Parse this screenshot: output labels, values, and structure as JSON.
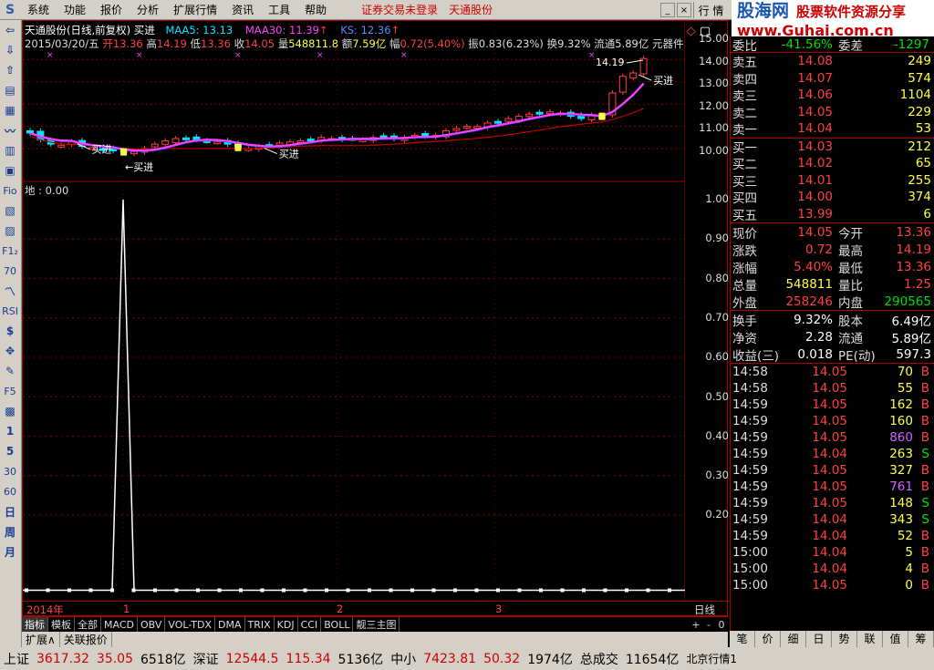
{
  "menu": {
    "logo": "S",
    "items": [
      "系统",
      "功能",
      "报价",
      "分析",
      "扩展行情",
      "资讯",
      "工具",
      "帮助"
    ],
    "alert": "证券交易未登录",
    "stock_name": "天通股份",
    "hq_tab": "行 情"
  },
  "brand": {
    "cn": "股海网",
    "slogan": "股票软件资源分享",
    "url": "www.Guhai.com.cn"
  },
  "toolbar": [
    "⇦",
    "⇩",
    "⇧",
    "▤",
    "▦",
    "〰",
    "▥",
    "▣",
    "Fio",
    "▧",
    "▨",
    "F1₂",
    "70",
    "〽",
    "RSI",
    "$",
    "✥",
    "✎",
    "F5",
    "▩",
    "1",
    "5",
    "30",
    "60",
    "日",
    "周",
    "月"
  ],
  "chart": {
    "line1": {
      "title": "天通股份(日线,前复权) 买进",
      "maa5": "MAA5: 13.13",
      "maa30": "MAA30: 11.39",
      "ks": "KS: 12.36"
    },
    "line2": {
      "date": "2015/03/20/五",
      "open_l": "开",
      "open": "13.36",
      "high_l": "高",
      "high": "14.19",
      "low_l": "低",
      "low": "13.36",
      "close_l": "收",
      "close": "14.05",
      "vol_l": "量",
      "vol": "548811.8",
      "amt_l": "额",
      "amt": "7.59亿",
      "chg_l": "幅",
      "chg": "0.72(5.40%)",
      "amp_l": "振",
      "amp": "0.83(6.23%)",
      "turn_l": "换",
      "turn": "9.32%",
      "float_l": "流通",
      "float": "5.89亿",
      "tool": "元器件"
    },
    "price_axis": [
      "15.00",
      "14.00",
      "13.00",
      "12.00",
      "11.00",
      "10.00"
    ],
    "high_marker": "14.19",
    "buy_labels": [
      "买进",
      "买进",
      "买进",
      "买进"
    ],
    "indicator_label": "地 : 0.00",
    "ind_axis": [
      "1.00",
      "0.90",
      "0.80",
      "0.70",
      "0.60",
      "0.50",
      "0.40",
      "0.30",
      "0.20"
    ],
    "dates": [
      "2014年",
      "1",
      "2",
      "3"
    ],
    "period": "日线"
  },
  "bottom_tabs": [
    "指标",
    "模板",
    "全部",
    "MACD",
    "OBV",
    "VOL-TDX",
    "DMA",
    "TRIX",
    "KDJ",
    "CCI",
    "BOLL",
    "靓三主图"
  ],
  "bottom_tabs_right": [
    "+",
    "-",
    "0"
  ],
  "bottom_tabs2": [
    "扩展∧",
    "关联报价"
  ],
  "quote": {
    "wb": {
      "label": "委比",
      "value": "-41.56%",
      "label2": "委差",
      "value2": "-1297"
    },
    "asks": [
      {
        "label": "卖五",
        "price": "14.08",
        "vol": "249"
      },
      {
        "label": "卖四",
        "price": "14.07",
        "vol": "574"
      },
      {
        "label": "卖三",
        "price": "14.06",
        "vol": "1104"
      },
      {
        "label": "卖二",
        "price": "14.05",
        "vol": "229"
      },
      {
        "label": "卖一",
        "price": "14.04",
        "vol": "53"
      }
    ],
    "bids": [
      {
        "label": "买一",
        "price": "14.03",
        "vol": "212"
      },
      {
        "label": "买二",
        "price": "14.02",
        "vol": "65"
      },
      {
        "label": "买三",
        "price": "14.01",
        "vol": "255"
      },
      {
        "label": "买四",
        "price": "14.00",
        "vol": "374"
      },
      {
        "label": "买五",
        "price": "13.99",
        "vol": "6"
      }
    ],
    "stats1": [
      {
        "k1": "现价",
        "v1": "14.05",
        "c1": "red",
        "k2": "今开",
        "v2": "13.36",
        "c2": "red"
      },
      {
        "k1": "涨跌",
        "v1": "0.72",
        "c1": "red",
        "k2": "最高",
        "v2": "14.19",
        "c2": "red"
      },
      {
        "k1": "涨幅",
        "v1": "5.40%",
        "c1": "red",
        "k2": "最低",
        "v2": "13.36",
        "c2": "red"
      },
      {
        "k1": "总量",
        "v1": "548811",
        "c1": "yel",
        "k2": "量比",
        "v2": "1.25",
        "c2": "red"
      },
      {
        "k1": "外盘",
        "v1": "258246",
        "c1": "red",
        "k2": "内盘",
        "v2": "290565",
        "c2": "green"
      }
    ],
    "stats2": [
      {
        "k1": "换手",
        "v1": "9.32%",
        "c1": "white",
        "k2": "股本",
        "v2": "6.49亿",
        "c2": "white"
      },
      {
        "k1": "净资",
        "v1": "2.28",
        "c1": "white",
        "k2": "流通",
        "v2": "5.89亿",
        "c2": "white"
      },
      {
        "k1": "收益(三)",
        "v1": "0.018",
        "c1": "white",
        "k2": "PE(动)",
        "v2": "597.3",
        "c2": "white"
      }
    ],
    "ticks": [
      {
        "t": "14:58",
        "p": "14.05",
        "v": "70",
        "d": "B"
      },
      {
        "t": "14:58",
        "p": "14.05",
        "v": "55",
        "d": "B"
      },
      {
        "t": "14:59",
        "p": "14.05",
        "v": "162",
        "d": "B"
      },
      {
        "t": "14:59",
        "p": "14.05",
        "v": "160",
        "d": "B"
      },
      {
        "t": "14:59",
        "p": "14.05",
        "v": "860",
        "d": "B"
      },
      {
        "t": "14:59",
        "p": "14.04",
        "v": "263",
        "d": "S"
      },
      {
        "t": "14:59",
        "p": "14.05",
        "v": "327",
        "d": "B"
      },
      {
        "t": "14:59",
        "p": "14.05",
        "v": "761",
        "d": "B"
      },
      {
        "t": "14:59",
        "p": "14.05",
        "v": "148",
        "d": "S"
      },
      {
        "t": "14:59",
        "p": "14.04",
        "v": "343",
        "d": "S"
      },
      {
        "t": "14:59",
        "p": "14.04",
        "v": "52",
        "d": "B"
      },
      {
        "t": "15:00",
        "p": "14.04",
        "v": "5",
        "d": "B"
      },
      {
        "t": "15:00",
        "p": "14.04",
        "v": "4",
        "d": "B"
      },
      {
        "t": "15:00",
        "p": "14.05",
        "v": "0",
        "d": "B"
      }
    ],
    "tabs": [
      "笔",
      "价",
      "细",
      "日",
      "势",
      "联",
      "值",
      "筹"
    ]
  },
  "status": {
    "sh_l": "上证",
    "sh": "3617.32",
    "sh_c": "35.05",
    "sh_a": "6518亿",
    "sz_l": "深证",
    "sz": "12544.5",
    "sz_c": "115.34",
    "sz_a": "5136亿",
    "zx_l": "中小",
    "zx": "7423.81",
    "zx_c": "50.32",
    "zx_a": "1974亿",
    "tot_l": "总成交",
    "tot": "11654亿",
    "bj": "北京行情1"
  }
}
